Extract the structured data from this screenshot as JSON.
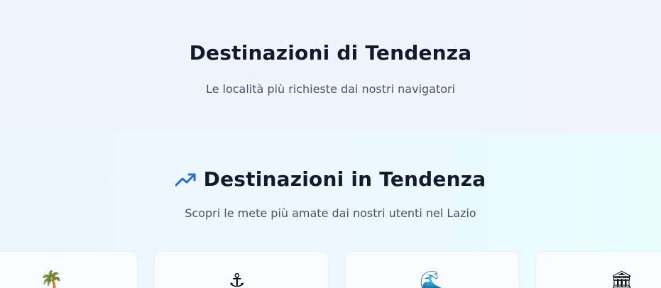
{
  "hero": {
    "title": "Destinazioni di Tendenza",
    "subtitle": "Le località più richieste dai nostri navigatori"
  },
  "trending": {
    "title": "Destinazioni in Tendenza",
    "subtitle": "Scopri le mete più amate dai nostri utenti nel Lazio",
    "icon": "trending-up-icon",
    "accent": "#2f66d9"
  },
  "cards": [
    {
      "emoji": "🌴",
      "icon": "palm-tree-icon"
    },
    {
      "emoji": "⚓",
      "icon": "anchor-icon"
    },
    {
      "emoji": "🌊",
      "icon": "wave-icon"
    },
    {
      "emoji": "🏛",
      "icon": "classical-building-icon"
    }
  ]
}
